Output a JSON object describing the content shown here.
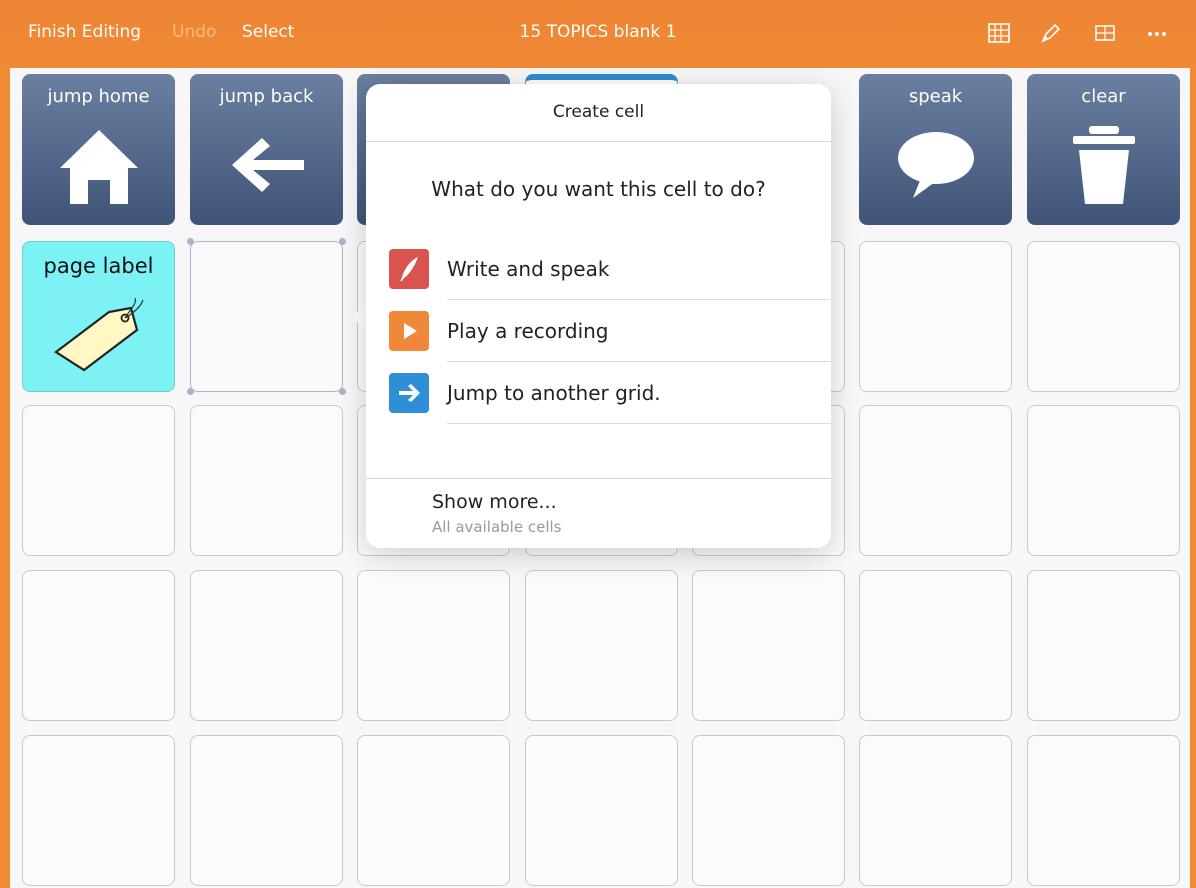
{
  "toolbar": {
    "finish_label": "Finish Editing",
    "undo_label": "Undo",
    "select_label": "Select",
    "title": "15 TOPICS blank 1",
    "icons": [
      "grid-layout-icon",
      "pen-tool-icon",
      "table-icon",
      "more-icon"
    ]
  },
  "cells": {
    "jump_home": {
      "label": "jump home",
      "icon": "home-icon"
    },
    "jump_back": {
      "label": "jump back",
      "icon": "arrow-left-icon"
    },
    "speak": {
      "label": "speak",
      "icon": "speech-bubble-icon"
    },
    "clear": {
      "label": "clear",
      "icon": "trash-icon"
    },
    "page_label": {
      "label": "page label",
      "icon": "tag-icon"
    }
  },
  "popover": {
    "title": "Create cell",
    "question": "What do you want this cell to do?",
    "options": [
      {
        "label": "Write and speak",
        "icon": "quill-icon",
        "color": "#d9534f"
      },
      {
        "label": "Play a recording",
        "icon": "play-icon",
        "color": "#f0883a"
      },
      {
        "label": "Jump to another grid.",
        "icon": "arrow-right-icon",
        "color": "#2f8fd6"
      }
    ],
    "more_title": "Show more...",
    "more_subtitle": "All available cells"
  },
  "colors": {
    "accent": "#f08a35",
    "action_cell": "#4d6387",
    "label_cell": "#7df2f4"
  }
}
